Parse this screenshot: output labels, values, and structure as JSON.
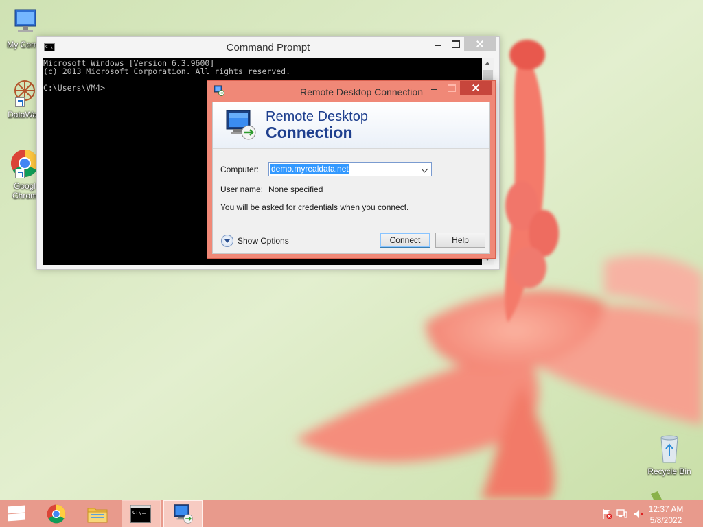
{
  "desktop": {
    "icons": [
      {
        "label": "My Comp"
      },
      {
        "label": "DataWag"
      },
      {
        "label": "Googl Chrom"
      },
      {
        "label": "Recycle Bin"
      }
    ]
  },
  "cmd_window": {
    "title": "Command Prompt",
    "lines": [
      "Microsoft Windows [Version 6.3.9600]",
      "(c) 2013 Microsoft Corporation. All rights reserved.",
      "",
      "C:\\Users\\VM4>"
    ]
  },
  "rdp_window": {
    "title": "Remote Desktop Connection",
    "banner_line1": "Remote Desktop",
    "banner_line2": "Connection",
    "computer_label": "Computer:",
    "computer_value": "demo.myrealdata.net",
    "username_label": "User name:",
    "username_value": "None specified",
    "credentials_note": "You will be asked for credentials when you connect.",
    "show_options_label": "Show Options",
    "connect_label": "Connect",
    "help_label": "Help"
  },
  "taskbar": {
    "pinned": [
      "start-button",
      "chrome-icon",
      "file-explorer-icon",
      "command-prompt-icon",
      "remote-desktop-icon"
    ],
    "clock_time": "12:37 AM",
    "clock_date": "5/8/2022",
    "tray_icons": [
      "action-center-flag-icon",
      "network-icon",
      "volume-muted-icon"
    ]
  },
  "colors": {
    "taskbar": "#e89a8c",
    "active_window_frame": "#f08877",
    "rdp_banner_text": "#1e3f8e",
    "selection": "#3399ff"
  }
}
